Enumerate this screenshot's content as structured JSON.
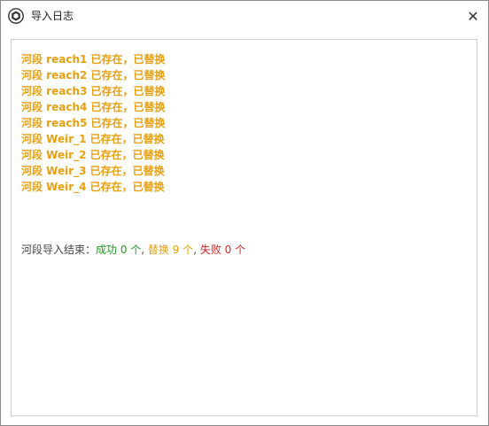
{
  "window": {
    "title": "导入日志",
    "close_label": "✕"
  },
  "colors": {
    "warning": "#e8a010",
    "success": "#1e9a1e",
    "error": "#dd2222",
    "text": "#444444"
  },
  "log_lines": [
    "河段 reach1 已存在，已替换",
    "河段 reach2 已存在，已替换",
    "河段 reach3 已存在，已替换",
    "河段 reach4 已存在，已替换",
    "河段 reach5 已存在，已替换",
    "河段 Weir_1 已存在，已替换",
    "河段 Weir_2 已存在，已替换",
    "河段 Weir_3 已存在，已替换",
    "河段 Weir_4 已存在，已替换"
  ],
  "summary": {
    "prefix": "河段导入结束：",
    "success": "成功 0 个",
    "sep1": ", ",
    "replaced": "替换 9 个",
    "sep2": ", ",
    "failed": "失败 0 个"
  }
}
